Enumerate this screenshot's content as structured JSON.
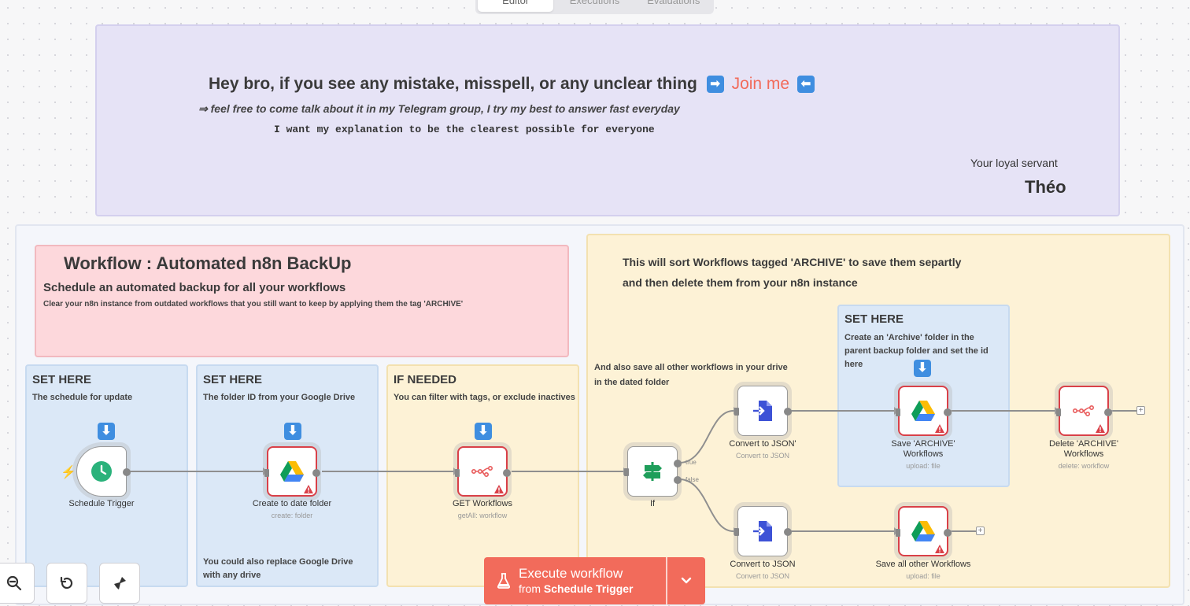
{
  "tabs": [
    {
      "label": "Editor",
      "active": true
    },
    {
      "label": "Executions",
      "active": false
    },
    {
      "label": "Evaluations",
      "active": false
    }
  ],
  "intro_note": {
    "headline_prefix": "Hey bro, if you see any mistake, misspell, or any unclear thing",
    "headline_link": "Join me",
    "subline": "⇒ feel free to come talk about it in my Telegram group, I try my best to answer fast everyday",
    "mono_line": "I want my explanation to be the clearest possible for everyone",
    "signoff_line": "Your loyal servant",
    "signature": "Théo",
    "link_color": "#f26b5b"
  },
  "title_note": {
    "title": "Workflow : Automated n8n BackUp",
    "subtitle": "Schedule an automated backup for all your workflows",
    "description": "Clear your n8n instance from outdated workflows that you still want to keep by applying them the tag 'ARCHIVE'"
  },
  "archive_note": {
    "line1": "This will sort Workflows tagged 'ARCHIVE' to save them separtly",
    "line2": "and then delete them from your n8n instance",
    "side_note_1": "And also save all other workflows in your drive",
    "side_note_2": "in the dated folder"
  },
  "set_notes": {
    "schedule": {
      "heading": "SET HERE",
      "text": "The schedule for update"
    },
    "folder": {
      "heading": "SET HERE",
      "text": "The folder ID from your Google Drive",
      "footer": "You could also replace Google Drive with any drive"
    },
    "filter": {
      "heading": "IF NEEDED",
      "text": "You can filter with tags, or exclude inactives"
    },
    "archive": {
      "heading": "SET HERE",
      "text": "Create an 'Archive' folder in the parent backup folder and set the id here"
    }
  },
  "nodes": {
    "schedule_trigger": {
      "label": "Schedule Trigger",
      "sub": ""
    },
    "create_folder": {
      "label": "Create to date folder",
      "sub": "create: folder"
    },
    "get_workflows": {
      "label": "GET Workflows",
      "sub": "getAll: workflow"
    },
    "if_node": {
      "label": "If",
      "sub": "",
      "true_label": "true",
      "false_label": "false"
    },
    "convert_json_top": {
      "label": "Convert to JSON'",
      "sub": "Convert to JSON"
    },
    "save_archive": {
      "label": "Save 'ARCHIVE' Workflows",
      "sub": "upload: file"
    },
    "delete_archive": {
      "label": "Delete 'ARCHIVE' Workflows",
      "sub": "delete: workflow"
    },
    "convert_json_bottom": {
      "label": "Convert to JSON",
      "sub": "Convert to JSON"
    },
    "save_others": {
      "label": "Save all other Workflows",
      "sub": "upload: file"
    }
  },
  "execute_button": {
    "line1": "Execute workflow",
    "line2_prefix": "from",
    "line2_target": "Schedule Trigger"
  },
  "controls": [
    "zoom-out-icon",
    "undo-icon",
    "clear-execution-icon"
  ],
  "colors": {
    "accent": "#f26b5b",
    "sticky_purple": "#e6e3f6",
    "sticky_pink": "#fdd8dc",
    "sticky_blue": "#dbe8f7",
    "sticky_yellow": "#fdf2d6",
    "error_border": "#d94048",
    "schedule_green": "#2ab27b",
    "info_arrow": "#3f8ee0"
  }
}
